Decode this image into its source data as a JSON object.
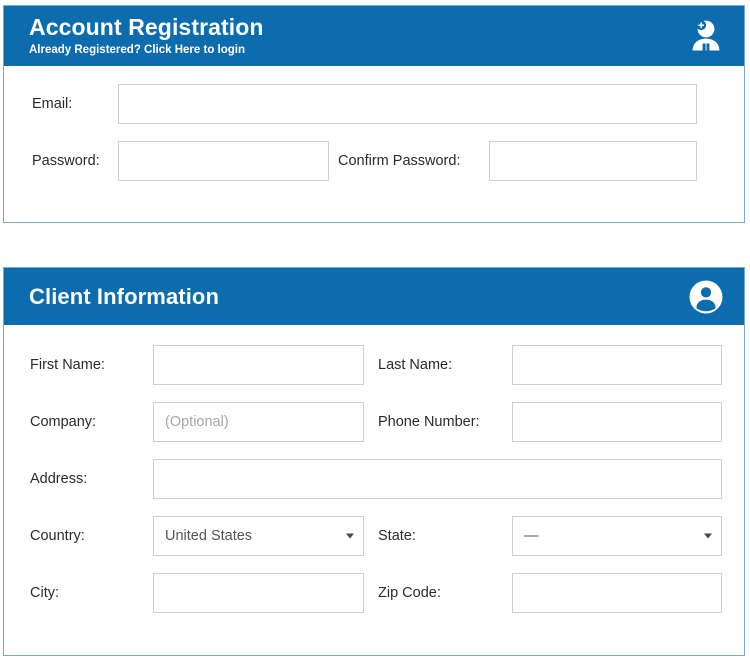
{
  "theme": {
    "header_blue": "#0d6cad",
    "card_border": "#7ba7c9",
    "input_border": "#cfcfcf",
    "label_color": "#2b2b2b",
    "placeholder_color": "#a6a6a6",
    "page_background": "#ffffff"
  },
  "account_card": {
    "title": "Account Registration",
    "subtitle": "Already Registered? Click Here to login",
    "icon": "add-user-icon",
    "fields": {
      "email": {
        "label": "Email:",
        "value": "",
        "placeholder": ""
      },
      "password": {
        "label": "Password:",
        "value": "",
        "placeholder": ""
      },
      "confirm_password": {
        "label": "Confirm Password:",
        "value": "",
        "placeholder": ""
      }
    }
  },
  "client_card": {
    "title": "Client Information",
    "icon": "account-circle-icon",
    "fields": {
      "first_name": {
        "label": "First Name:",
        "value": "",
        "placeholder": ""
      },
      "last_name": {
        "label": "Last Name:",
        "value": "",
        "placeholder": ""
      },
      "company": {
        "label": "Company:",
        "value": "",
        "placeholder": "(Optional)"
      },
      "phone_number": {
        "label": "Phone Number:",
        "value": "",
        "placeholder": ""
      },
      "address": {
        "label": "Address:",
        "value": "",
        "placeholder": ""
      },
      "country": {
        "label": "Country:",
        "selected": "United States"
      },
      "state": {
        "label": "State:",
        "selected": "—"
      },
      "city": {
        "label": "City:",
        "value": "",
        "placeholder": ""
      },
      "zip_code": {
        "label": "Zip Code:",
        "value": "",
        "placeholder": ""
      }
    }
  }
}
